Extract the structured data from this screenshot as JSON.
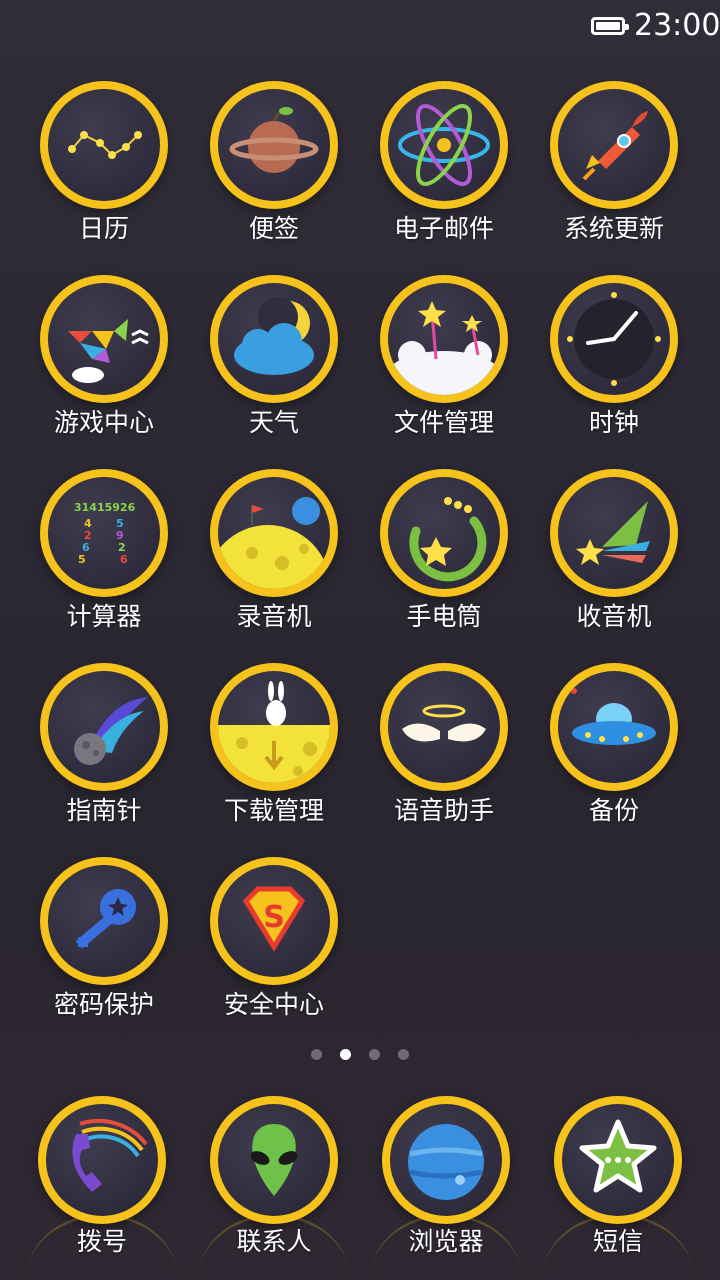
{
  "status": {
    "time": "23:00",
    "battery_icon": "battery-full-icon"
  },
  "apps": [
    {
      "label": "日历",
      "icon": "constellation-icon"
    },
    {
      "label": "便签",
      "icon": "planet-icon"
    },
    {
      "label": "电子邮件",
      "icon": "atom-icon"
    },
    {
      "label": "系统更新",
      "icon": "rocket-icon"
    },
    {
      "label": "游戏中心",
      "icon": "tangram-bird-icon"
    },
    {
      "label": "天气",
      "icon": "moon-cloud-icon"
    },
    {
      "label": "文件管理",
      "icon": "star-wands-cloud-icon"
    },
    {
      "label": "时钟",
      "icon": "clock-icon"
    },
    {
      "label": "计算器",
      "icon": "pi-numbers-icon"
    },
    {
      "label": "录音机",
      "icon": "moon-flag-icon"
    },
    {
      "label": "手电筒",
      "icon": "star-swirl-icon"
    },
    {
      "label": "收音机",
      "icon": "shooting-star-icon"
    },
    {
      "label": "指南针",
      "icon": "comet-icon"
    },
    {
      "label": "下载管理",
      "icon": "rabbit-moon-icon"
    },
    {
      "label": "语音助手",
      "icon": "angel-wings-icon"
    },
    {
      "label": "备份",
      "icon": "ufo-icon"
    },
    {
      "label": "密码保护",
      "icon": "key-icon"
    },
    {
      "label": "安全中心",
      "icon": "superman-shield-icon"
    }
  ],
  "page_dots": {
    "count": 4,
    "active_index": 1
  },
  "dock": [
    {
      "label": "拨号",
      "icon": "phone-rainbow-icon"
    },
    {
      "label": "联系人",
      "icon": "alien-icon"
    },
    {
      "label": "浏览器",
      "icon": "blue-planet-icon"
    },
    {
      "label": "短信",
      "icon": "star-chat-icon"
    }
  ],
  "colors": {
    "ring": "#f6c21c",
    "icon_bg": "#2e2c3c",
    "background": "#2b2833"
  }
}
